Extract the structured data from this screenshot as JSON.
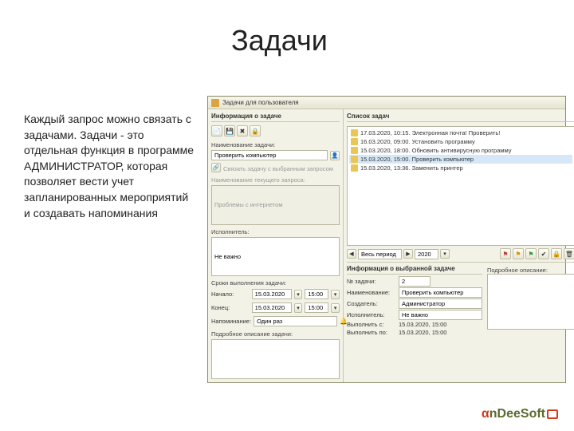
{
  "slide": {
    "title": "Задачи",
    "text": "Каждый запрос можно связать с задачами. Задачи - это отдельная функция в программе АДМИНИСТРАТОР, которая позволяет вести учет запланированных мероприятий и создавать напоминания"
  },
  "app": {
    "title": "Задачи для пользователя"
  },
  "left": {
    "header": "Информация о задаче",
    "name_label": "Наименование задачи:",
    "name_value": "Проверить компьютер",
    "link_label": "Связать задачу с выбранным запросом",
    "request_label": "Наименование текущего запроса:",
    "request_value": "Проблемы с интернетом",
    "executor_label": "Исполнитель:",
    "executor_value": "Не важно",
    "deadline_label": "Сроки выполнения задачи:",
    "start_label": "Начало:",
    "end_label": "Конец:",
    "date_start": "15.03.2020",
    "time_start": "15:00",
    "date_end": "15.03.2020",
    "time_end": "15:00",
    "reminder_label": "Напоминание:",
    "reminder_value": "Один раз",
    "desc_label": "Подробное описание задачи:"
  },
  "right": {
    "header": "Список задач",
    "tasks": [
      "17.03.2020, 10:15. Электронная почта! Проверить!",
      "16.03.2020, 09:00. Установить программу",
      "15.03.2020, 18:00. Обновить антивирусную программу",
      "15.03.2020, 15:00. Проверить компьютер",
      "15.03.2020, 13:36. Заменить принтер"
    ],
    "period_label": "Весь период",
    "year": "2020"
  },
  "info": {
    "header": "Информация о выбранной задаче",
    "num_label": "№ задачи:",
    "num_value": "2",
    "name_label": "Наименование:",
    "name_value": "Проверить компьютер",
    "creator_label": "Создатель:",
    "creator_value": "Администратор",
    "executor_label": "Исполнитель:",
    "executor_value": "Не важно",
    "from_label": "Выполнить с:",
    "from_value": "15.03.2020, 15:00",
    "to_label": "Выполнить по:",
    "to_value": "15.03.2020, 15:00",
    "desc_label": "Подробное описание:"
  },
  "logo": {
    "a": "α",
    "rest": "nDeeSoft"
  }
}
